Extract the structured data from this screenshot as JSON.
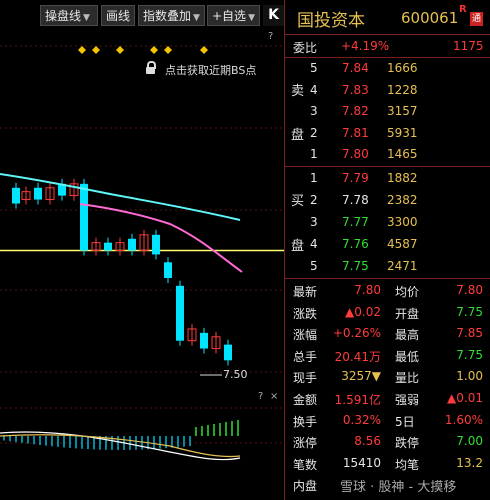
{
  "toolbar": {
    "btn_draw_market": "操盘线",
    "btn_draw_line": "画线",
    "btn_overlay": "指数叠加",
    "btn_add_fav": "+自选",
    "collapse": "K"
  },
  "chart": {
    "bs_tip": "点击获取近期BS点",
    "low_label": "7.50",
    "q1": "?",
    "q2": "?",
    "diamonds": 5,
    "colors": {
      "up": "#ff3b3b",
      "down": "#00e5ff",
      "ma_cyan": "#5ef6f6",
      "ma_pink": "#ff6ad5",
      "ref_line": "#ffff66"
    }
  },
  "chart_data": {
    "type": "candlestick",
    "reference_price": 7.8,
    "low_marker": 7.5,
    "candles_approx": [
      {
        "o": 7.96,
        "c": 7.92,
        "dir": "down"
      },
      {
        "o": 7.95,
        "c": 7.92,
        "dir": "down"
      },
      {
        "o": 7.93,
        "c": 7.95,
        "dir": "up"
      },
      {
        "o": 7.96,
        "c": 7.93,
        "dir": "down"
      },
      {
        "o": 7.93,
        "c": 7.96,
        "dir": "up"
      },
      {
        "o": 7.97,
        "c": 7.94,
        "dir": "down"
      },
      {
        "o": 7.94,
        "c": 7.97,
        "dir": "up"
      },
      {
        "o": 7.97,
        "c": 7.8,
        "dir": "down"
      },
      {
        "o": 7.8,
        "c": 7.82,
        "dir": "up"
      },
      {
        "o": 7.82,
        "c": 7.8,
        "dir": "down"
      },
      {
        "o": 7.8,
        "c": 7.82,
        "dir": "up"
      },
      {
        "o": 7.83,
        "c": 7.8,
        "dir": "down"
      },
      {
        "o": 7.8,
        "c": 7.84,
        "dir": "up"
      },
      {
        "o": 7.84,
        "c": 7.79,
        "dir": "down"
      },
      {
        "o": 7.77,
        "c": 7.73,
        "dir": "down"
      },
      {
        "o": 7.71,
        "c": 7.57,
        "dir": "down"
      },
      {
        "o": 7.57,
        "c": 7.6,
        "dir": "up"
      },
      {
        "o": 7.59,
        "c": 7.55,
        "dir": "down"
      },
      {
        "o": 7.55,
        "c": 7.58,
        "dir": "up"
      },
      {
        "o": 7.56,
        "c": 7.52,
        "dir": "down"
      },
      {
        "o": 7.55,
        "c": 7.56,
        "dir": "up"
      },
      {
        "o": 7.56,
        "c": 7.65,
        "dir": "up"
      },
      {
        "o": 7.65,
        "c": 7.68,
        "dir": "up"
      }
    ]
  },
  "quote": {
    "name": "国投资本",
    "code": "600061",
    "r_badge": "R",
    "tong_badge": "通",
    "weibi_label": "委比",
    "weibi_value": "+4.19%",
    "weibi_diff": "1175",
    "sell_side": "卖",
    "sell_side2": "盘",
    "buy_side": "买",
    "buy_side2": "盘",
    "sell": [
      {
        "level": "5",
        "price": "7.84",
        "vol": "1666"
      },
      {
        "level": "4",
        "price": "7.83",
        "vol": "1228"
      },
      {
        "level": "3",
        "price": "7.82",
        "vol": "3157"
      },
      {
        "level": "2",
        "price": "7.81",
        "vol": "5931"
      },
      {
        "level": "1",
        "price": "7.80",
        "vol": "1465"
      }
    ],
    "buy": [
      {
        "level": "1",
        "price": "7.79",
        "vol": "1882"
      },
      {
        "level": "2",
        "price": "7.78",
        "vol": "2382"
      },
      {
        "level": "3",
        "price": "7.77",
        "vol": "3300"
      },
      {
        "level": "4",
        "price": "7.76",
        "vol": "4587"
      },
      {
        "level": "5",
        "price": "7.75",
        "vol": "2471"
      }
    ],
    "stats": [
      {
        "l1": "最新",
        "v1": "7.80",
        "l2": "均价",
        "v2": "7.80"
      },
      {
        "l1": "涨跌",
        "v1": "▲0.02",
        "l2": "开盘",
        "v2": "7.75"
      },
      {
        "l1": "涨幅",
        "v1": "+0.26%",
        "l2": "最高",
        "v2": "7.85"
      },
      {
        "l1": "总手",
        "v1": "20.41万",
        "l2": "最低",
        "v2": "7.75"
      },
      {
        "l1": "现手",
        "v1": "3257▼",
        "l2": "量比",
        "v2": "1.00"
      },
      {
        "l1": "金额",
        "v1": "1.591亿",
        "l2": "强弱",
        "v2": "▲0.01"
      },
      {
        "l1": "换手",
        "v1": "0.32%",
        "l2": "5日",
        "v2": "1.60%"
      },
      {
        "l1": "涨停",
        "v1": "8.56",
        "l2": "跌停",
        "v2": "7.00"
      },
      {
        "l1": "笔数",
        "v1": "15410",
        "l2": "均笔",
        "v2": "13.2"
      },
      {
        "l1": "内盘",
        "v1": "",
        "l2": "",
        "v2": ""
      }
    ],
    "watermark": "雪球 · 股神 - 大摸移"
  }
}
